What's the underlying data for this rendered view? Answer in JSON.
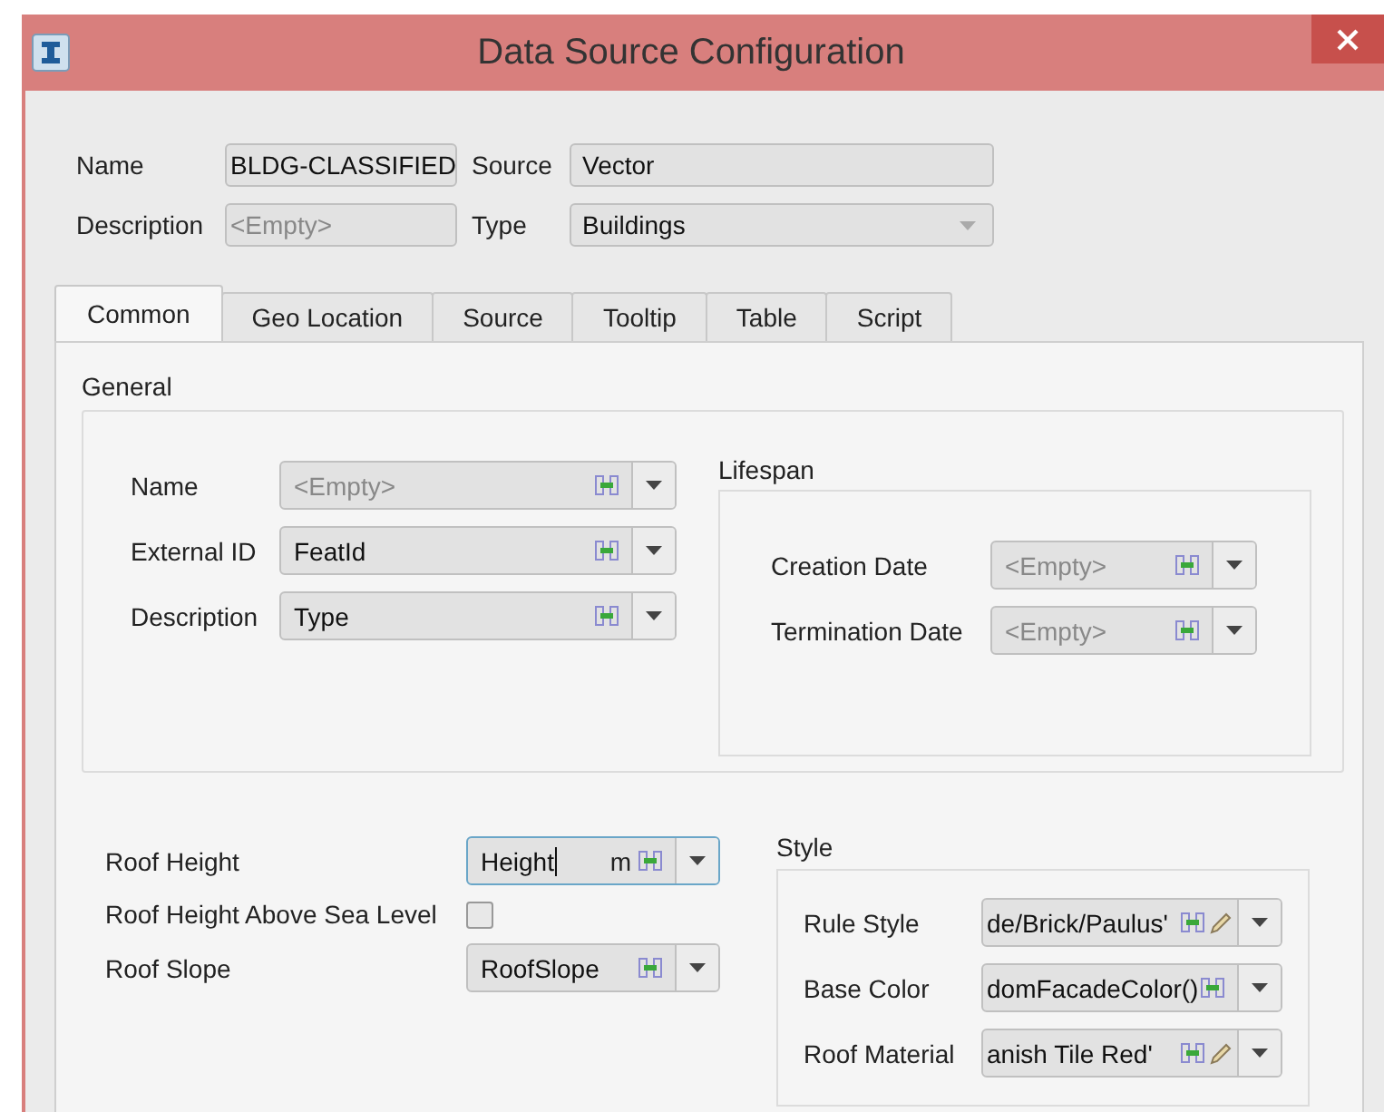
{
  "window": {
    "title": "Data Source Configuration"
  },
  "header": {
    "fields": [
      {
        "label": "Name",
        "kind": "text",
        "value": "BLDG-CLASSIFIED"
      },
      {
        "label": "Source",
        "kind": "text",
        "value": "Vector"
      },
      {
        "label": "Description",
        "kind": "text",
        "placeholder": "<Empty>"
      },
      {
        "label": "Type",
        "kind": "combo",
        "value": "Buildings"
      }
    ]
  },
  "tabs": [
    {
      "label": "Common",
      "selected": true
    },
    {
      "label": "Geo Location",
      "selected": false
    },
    {
      "label": "Source",
      "selected": false
    },
    {
      "label": "Tooltip",
      "selected": false
    },
    {
      "label": "Table",
      "selected": false
    },
    {
      "label": "Script",
      "selected": false
    }
  ],
  "general": {
    "title": "General",
    "fields": [
      {
        "label": "Name",
        "placeholder": "<Empty>"
      },
      {
        "label": "External ID",
        "value": "FeatId"
      },
      {
        "label": "Description",
        "value": "Type"
      }
    ],
    "lifespan": {
      "title": "Lifespan",
      "fields": [
        {
          "label": "Creation Date",
          "placeholder": "<Empty>"
        },
        {
          "label": "Termination Date",
          "placeholder": "<Empty>"
        }
      ]
    }
  },
  "roof": [
    {
      "label": "Roof Height",
      "kind": "combo",
      "value": "Height",
      "unit": "m",
      "focused": true
    },
    {
      "label": "Roof Height Above Sea Level",
      "kind": "checkbox",
      "checked": false
    },
    {
      "label": "Roof Slope",
      "kind": "combo",
      "value": "RoofSlope",
      "focused": false
    }
  ],
  "style": {
    "title": "Style",
    "fields": [
      {
        "label": "Rule Style",
        "value": "de/Brick/Paulus'",
        "pencil": true
      },
      {
        "label": "Base Color",
        "value": "domFacadeColor()",
        "pencil": false
      },
      {
        "label": "Roof Material",
        "value": "anish Tile Red'",
        "pencil": true
      }
    ]
  }
}
